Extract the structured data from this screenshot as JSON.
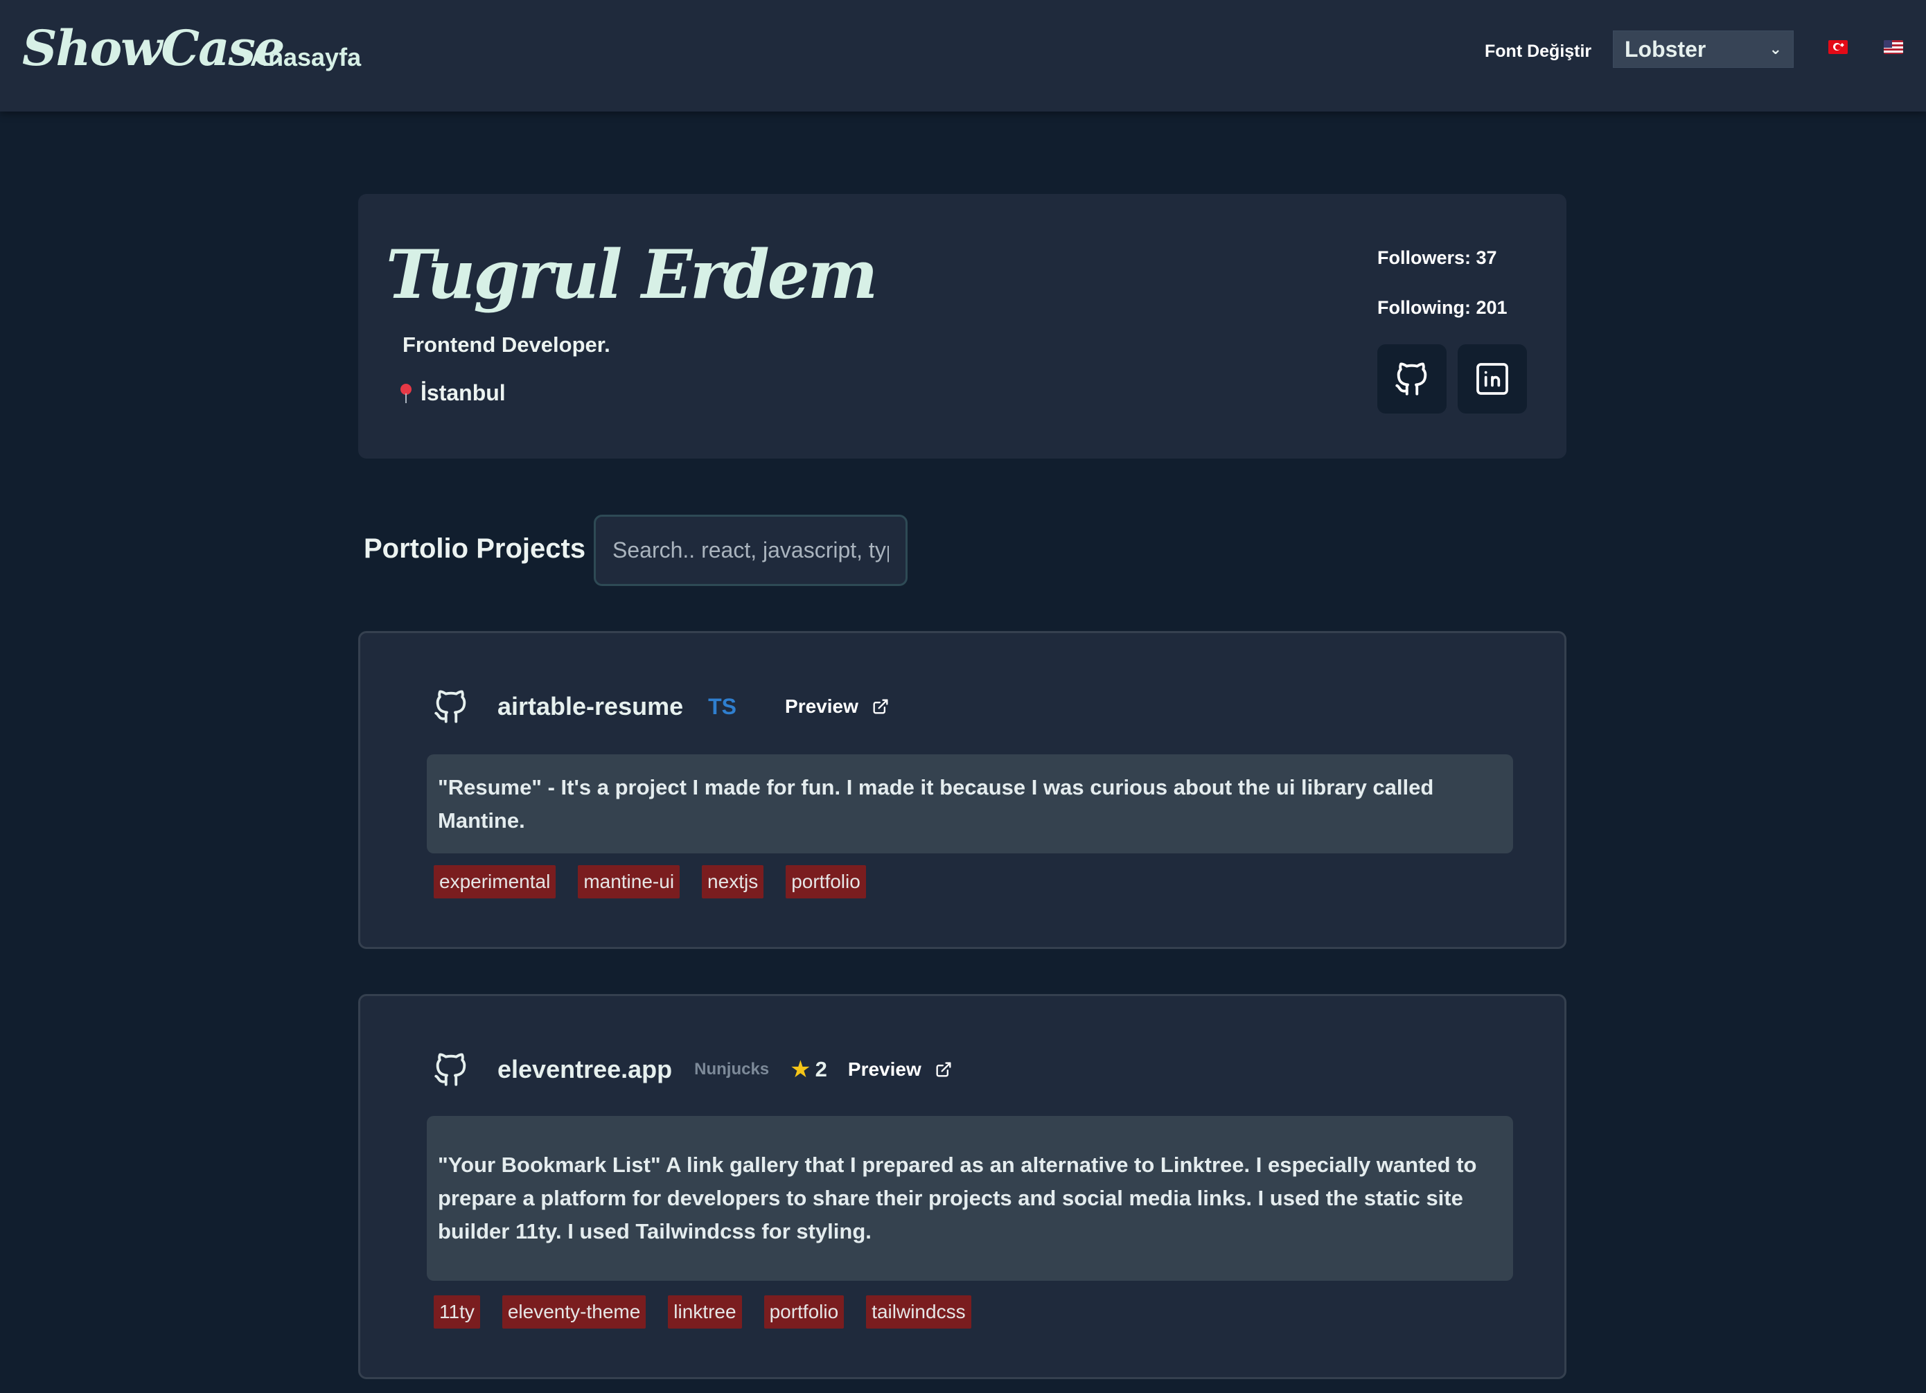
{
  "header": {
    "logo": "ShowCase",
    "home_link": "Anasayfa",
    "font_label": "Font Değiştir",
    "font_select_value": "Lobster",
    "languages": [
      "tr-flag-icon",
      "us-flag-icon"
    ]
  },
  "profile": {
    "name": "Tugrul Erdem",
    "title": "Frontend Developer.",
    "location": "İstanbul",
    "followers": "Followers: 37",
    "following": "Following: 201",
    "social": [
      "github-icon",
      "linkedin-icon"
    ]
  },
  "projects": {
    "title": "Portolio Projects",
    "search_placeholder": "Search.. react, javascript, typescript",
    "items": [
      {
        "name": "airtable-resume",
        "language": "TS",
        "preview": "Preview",
        "description": "\"Resume\" - It's a project I made for fun. I made it because I was curious about the ui library called Mantine.",
        "tags": [
          "experimental",
          "mantine-ui",
          "nextjs",
          "portfolio"
        ]
      },
      {
        "name": "eleventree.app",
        "language": "Nunjucks",
        "stars": "2",
        "preview": "Preview",
        "description": "\"Your Bookmark List\" A link gallery that I prepared as an alternative to Linktree. I especially wanted to prepare a platform for developers to share their projects and social media links. I used the static site builder 11ty. I used Tailwindcss for styling.",
        "tags": [
          "11ty",
          "eleventy-theme",
          "linktree",
          "portfolio",
          "tailwindcss"
        ]
      }
    ]
  },
  "colors": {
    "background": "#111e2e",
    "surface": "#1f2a3c",
    "accent_text": "#d7f0e6",
    "tag_bg": "#7a1d1f",
    "ts_blue": "#2f7fcf"
  }
}
